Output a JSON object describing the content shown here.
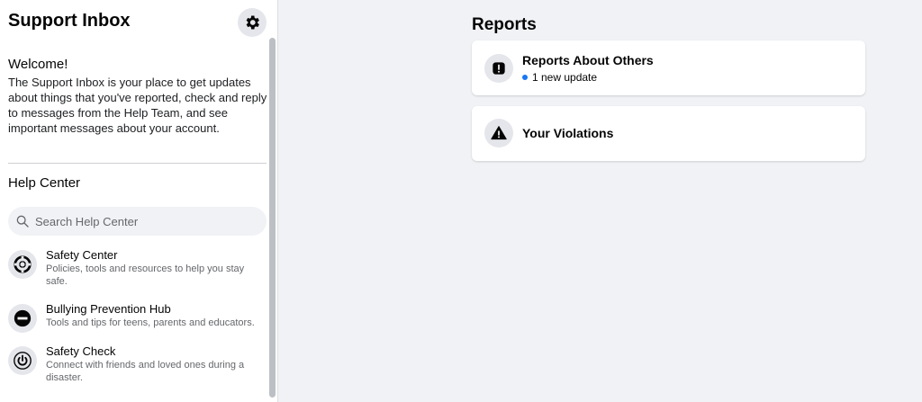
{
  "sidebar": {
    "title": "Support Inbox",
    "welcome": {
      "heading": "Welcome!",
      "text": "The Support Inbox is your place to get updates about things that you've reported, check and reply to messages from the Help Team, and see important messages about your account."
    },
    "help_center": {
      "title": "Help Center",
      "search_placeholder": "Search Help Center",
      "items": [
        {
          "name": "Safety Center",
          "description": "Policies, tools and resources to help you stay safe.",
          "icon": "lifebuoy-icon"
        },
        {
          "name": "Bullying Prevention Hub",
          "description": "Tools and tips for teens, parents and educators.",
          "icon": "no-entry-icon"
        },
        {
          "name": "Safety Check",
          "description": "Connect with friends and loved ones during a disaster.",
          "icon": "power-icon"
        }
      ]
    }
  },
  "main": {
    "title": "Reports",
    "cards": [
      {
        "title": "Reports About Others",
        "subtitle": "1 new update",
        "icon": "alert-icon"
      },
      {
        "title": "Your Violations",
        "icon": "warning-icon"
      }
    ]
  },
  "colors": {
    "accent": "#1877f2",
    "background": "#f0f2f5",
    "icon_circle": "#e4e6eb"
  }
}
